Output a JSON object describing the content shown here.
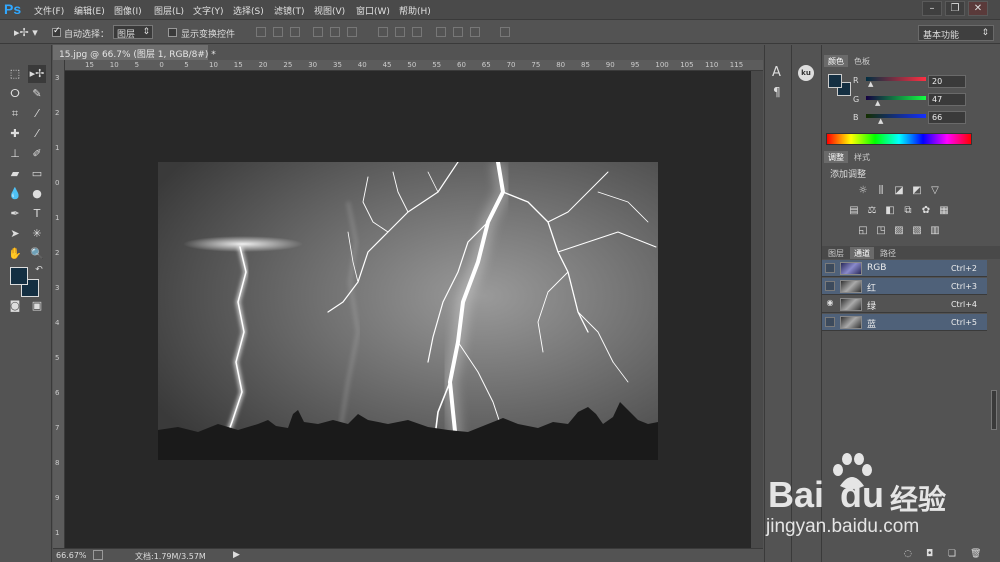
{
  "app": {
    "logo": "Ps"
  },
  "menu": [
    "文件(F)",
    "编辑(E)",
    "图像(I)",
    "图层(L)",
    "文字(Y)",
    "选择(S)",
    "滤镜(T)",
    "视图(V)",
    "窗口(W)",
    "帮助(H)"
  ],
  "options": {
    "auto_select_label": "自动选择：",
    "auto_select_value": "图层",
    "show_transform_label": "显示变换控件",
    "workspace": "基本功能"
  },
  "document": {
    "tab_title": "15.jpg @ 66.7% (图层 1, RGB/8#) *",
    "ruler_h": [
      "15",
      "10",
      "5",
      "0",
      "5",
      "10",
      "15",
      "20",
      "25",
      "30",
      "35",
      "40",
      "45",
      "50",
      "55",
      "60",
      "65",
      "70",
      "75",
      "80",
      "85",
      "90",
      "95",
      "100",
      "105",
      "110",
      "115"
    ],
    "ruler_v": [
      "3",
      "2",
      "1",
      "0",
      "1",
      "2",
      "3",
      "4",
      "5",
      "6",
      "7",
      "8",
      "9",
      "1"
    ]
  },
  "status": {
    "zoom": "66.67%",
    "doc_size": "文档:1.79M/3.57M"
  },
  "color_panel": {
    "tab_color": "颜色",
    "tab_swatches": "色板",
    "r_label": "R",
    "g_label": "G",
    "b_label": "B",
    "r": "20",
    "g": "47",
    "b": "66",
    "fg": "#142f42"
  },
  "adjust_panel": {
    "tab_adjust": "调整",
    "tab_styles": "样式",
    "title": "添加调整"
  },
  "channels_panel": {
    "tab_layers": "图层",
    "tab_channels": "通道",
    "tab_paths": "路径",
    "channels": [
      {
        "name": "RGB",
        "shortcut": "Ctrl+2"
      },
      {
        "name": "红",
        "shortcut": "Ctrl+3"
      },
      {
        "name": "绿",
        "shortcut": "Ctrl+4"
      },
      {
        "name": "蓝",
        "shortcut": "Ctrl+5"
      }
    ]
  },
  "watermark": {
    "brand": "Bai",
    "brand2": "du",
    "brand_cn": "经验",
    "url": "jingyan.baidu.com"
  }
}
